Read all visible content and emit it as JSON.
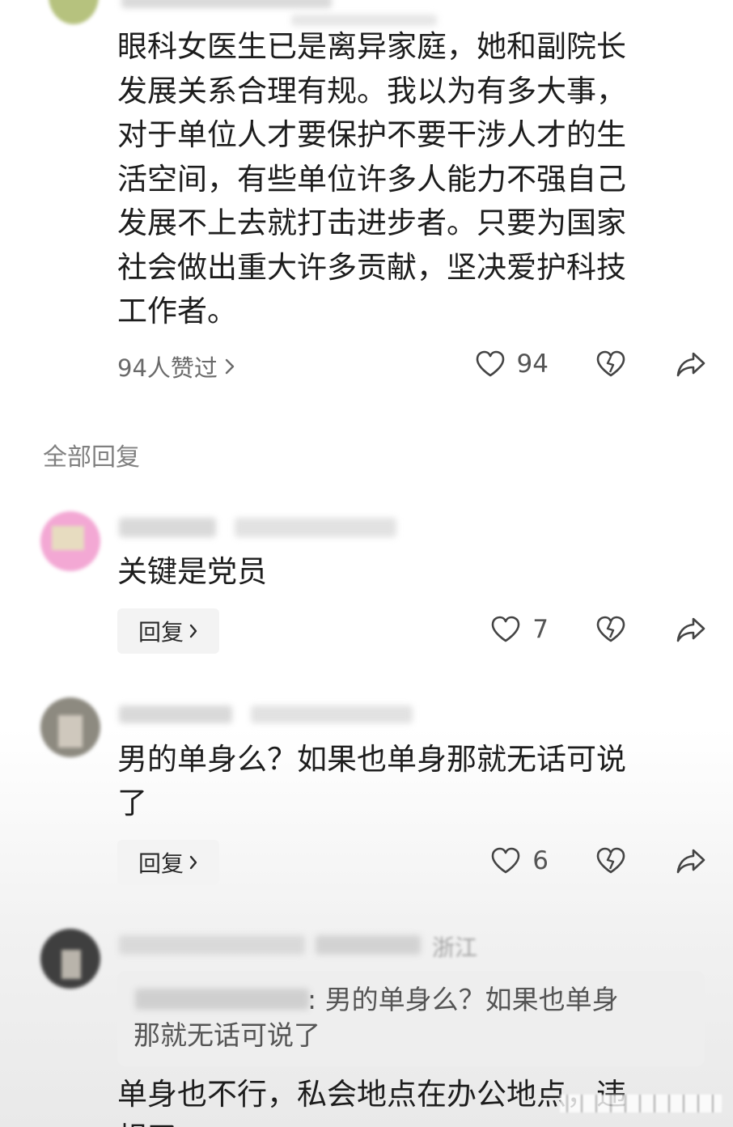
{
  "post": {
    "lines": [
      "眼科女医生已是离异家庭，她和副院长",
      "发展关系合理有规。我以为有多大事，",
      "对于单位人才要保护不要干涉人才的生",
      "活空间，有些单位许多人能力不强自己",
      "发展不上去就打击进步者。只要为国家",
      "社会做出重大许多贡献，坚决爱护科技",
      "工作者。"
    ],
    "likes_link": "94人赞过",
    "like_count": "94"
  },
  "section_title": "全部回复",
  "replies": [
    {
      "text_lines": [
        "关键是党员"
      ],
      "reply_label": "回复",
      "like_count": "7"
    },
    {
      "text_lines": [
        "男的单身么？如果也单身那就无话可说",
        "了"
      ],
      "reply_label": "回复",
      "like_count": "6"
    },
    {
      "location": "浙江",
      "quote_lines": [
        ":  男的单身么？如果也单身",
        "那就无话可说了"
      ],
      "text_lines": [
        "单身也不行，私会地点在办公地点，违",
        "规了"
      ]
    }
  ],
  "icons": {
    "heart": "heart-icon",
    "broken_heart": "dislike-icon",
    "share": "share-icon",
    "chevron": "chevron-right-icon"
  }
}
